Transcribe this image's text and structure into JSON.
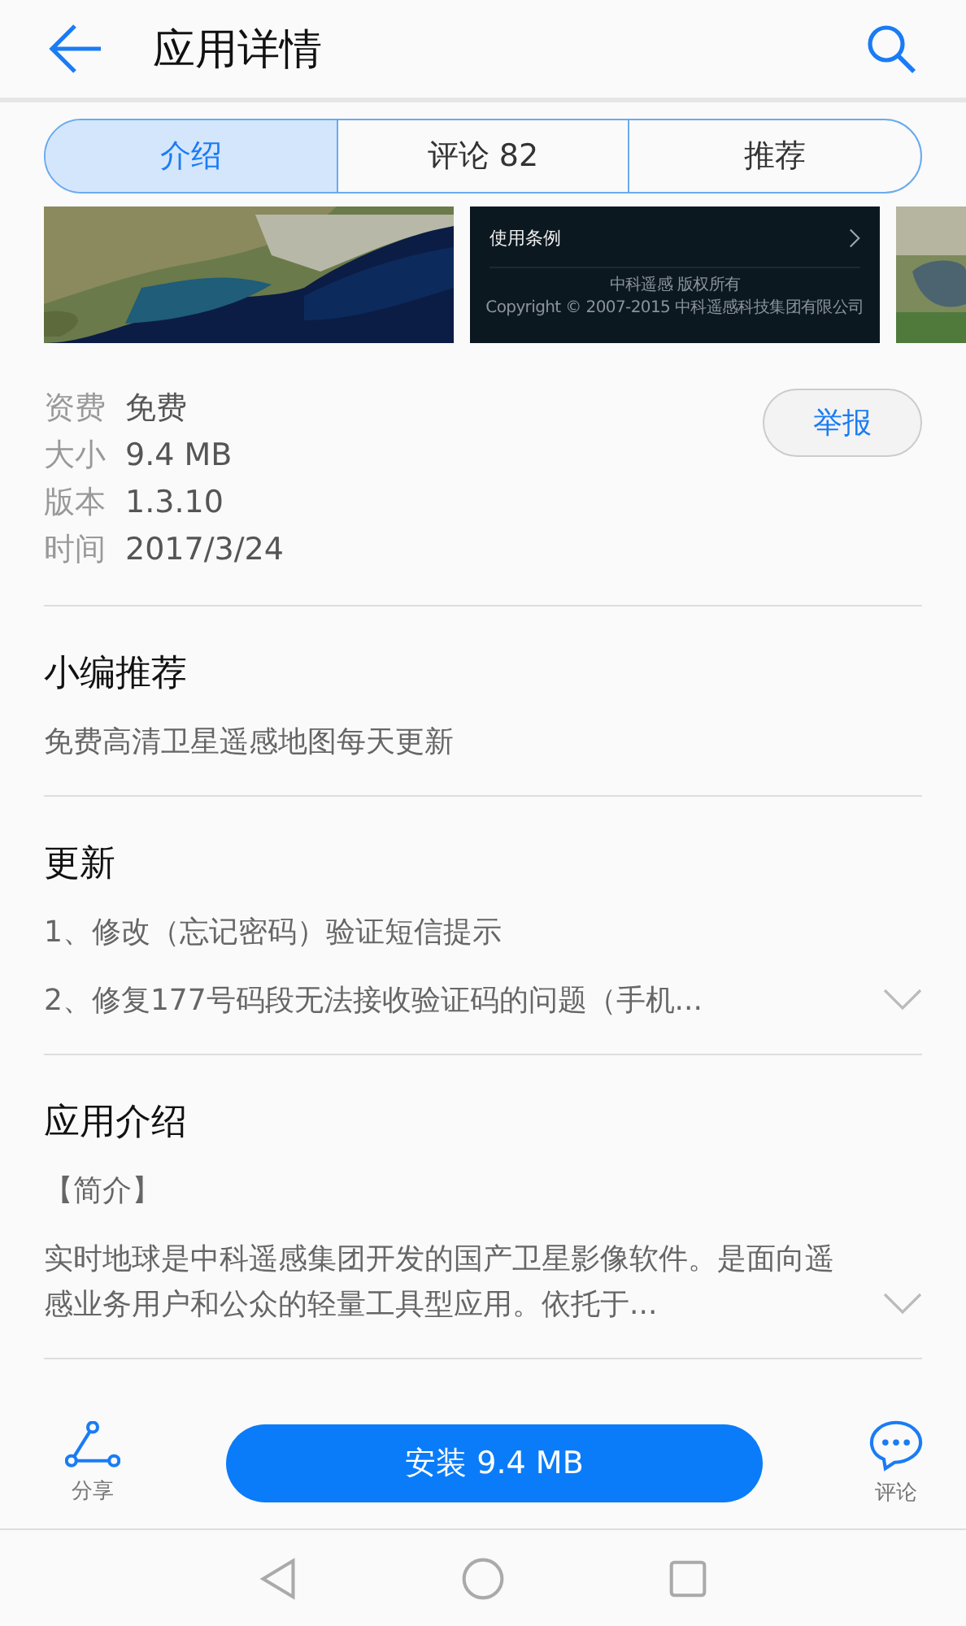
{
  "header": {
    "title": "应用详情"
  },
  "tabs": [
    {
      "label": "介绍",
      "selected": true
    },
    {
      "label": "评论  82",
      "selected": false
    },
    {
      "label": "推荐",
      "selected": false
    }
  ],
  "screenshots": [
    {
      "kind": "picture"
    },
    {
      "kind": "app",
      "rows": [
        {
          "label": "使用条例"
        }
      ],
      "footer": [
        "中科遥感 版权所有",
        "Copyright © 2007-2015 中科遥感科技集团有限公司"
      ]
    },
    {
      "kind": "picture"
    }
  ],
  "info": [
    {
      "label": "资费",
      "value": "免费"
    },
    {
      "label": "大小",
      "value": "9.4 MB"
    },
    {
      "label": "版本",
      "value": "1.3.10"
    },
    {
      "label": "时间",
      "value": "2017/3/24"
    }
  ],
  "report_button": "举报",
  "sections": [
    {
      "title": "小编推荐",
      "lines": [
        {
          "text": "免费高清卫星遥感地图每天更新",
          "expandable": false
        }
      ]
    },
    {
      "title": "更新",
      "lines": [
        {
          "text": "1、修改（忘记密码）验证短信提示",
          "expandable": false
        },
        {
          "text": "2、修复177号码段无法接收验证码的问题（手机...",
          "expandable": true
        }
      ]
    },
    {
      "title": "应用介绍",
      "lines": [
        {
          "text": "【简介】",
          "expandable": false
        },
        {
          "text": "实时地球是中科遥感集团开发的国产卫星影像软件。是面向遥感业务用户和公众的轻量工具型应用。依托于...",
          "expandable": true
        }
      ]
    }
  ],
  "bottom_bar": {
    "share": "分享",
    "install": "安装 9.4 MB",
    "comment": "评论"
  }
}
